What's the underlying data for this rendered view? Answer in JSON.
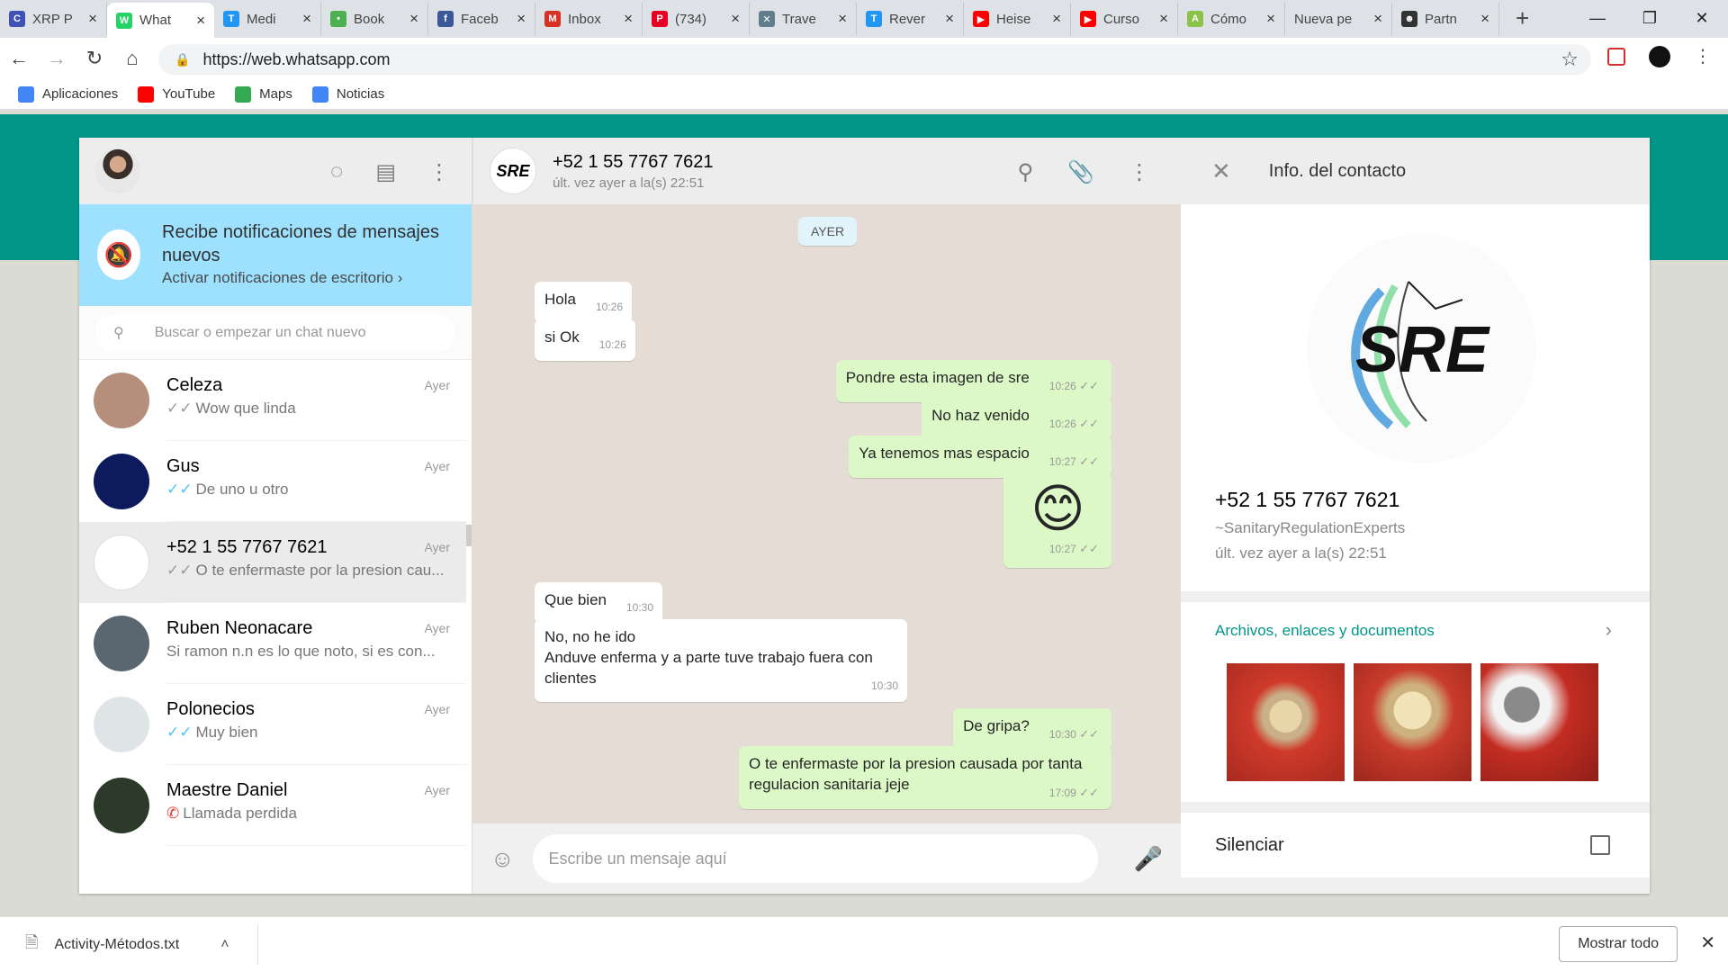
{
  "browser": {
    "tabs": [
      {
        "label": "XRP P",
        "color": "#3f51b5",
        "glyph": "C"
      },
      {
        "label": "What",
        "color": "#25d366",
        "glyph": "W",
        "active": true
      },
      {
        "label": "Medi",
        "color": "#2196f3",
        "glyph": "T"
      },
      {
        "label": "Book",
        "color": "#4caf50",
        "glyph": "•"
      },
      {
        "label": "Faceb",
        "color": "#3b5998",
        "glyph": "f"
      },
      {
        "label": "Inbox",
        "color": "#d93025",
        "glyph": "M"
      },
      {
        "label": "(734)",
        "color": "#e60023",
        "glyph": "P"
      },
      {
        "label": "Trave",
        "color": "#607d8b",
        "glyph": "✕"
      },
      {
        "label": "Rever",
        "color": "#2196f3",
        "glyph": "T"
      },
      {
        "label": "Heise",
        "color": "#ff0000",
        "glyph": "▶"
      },
      {
        "label": "Curso",
        "color": "#ff0000",
        "glyph": "▶"
      },
      {
        "label": "Cómo",
        "color": "#8bc34a",
        "glyph": "A"
      },
      {
        "label": "Nueva pe",
        "color": "",
        "glyph": ""
      },
      {
        "label": "Partn",
        "color": "#333333",
        "glyph": "☻"
      }
    ],
    "url": "https://web.whatsapp.com",
    "bookmarks": [
      {
        "label": "Aplicaciones",
        "color": "#4285f4"
      },
      {
        "label": "YouTube",
        "color": "#ff0000"
      },
      {
        "label": "Maps",
        "color": "#34a853"
      },
      {
        "label": "Noticias",
        "color": "#4285f4"
      }
    ]
  },
  "notification": {
    "title": "Recibe notificaciones de mensajes nuevos",
    "link": "Activar notificaciones de escritorio"
  },
  "search": {
    "placeholder": "Buscar o empezar un chat nuevo"
  },
  "chats": [
    {
      "name": "Celeza",
      "time": "Ayer",
      "preview": "Wow que linda",
      "tick": "gray",
      "avatar": "#b58f7c"
    },
    {
      "name": "Gus",
      "time": "Ayer",
      "preview": "De uno u otro",
      "tick": "blue",
      "avatar": "#0d1a5c"
    },
    {
      "name": "+52 1 55 7767 7621",
      "time": "Ayer",
      "preview": "O te enfermaste por la presion cau...",
      "tick": "gray",
      "avatar": "#ffffff",
      "selected": true
    },
    {
      "name": "Ruben Neonacare",
      "time": "Ayer",
      "preview": "Si ramon n.n es lo que noto, si es con...",
      "tick": "",
      "avatar": "#5a6670"
    },
    {
      "name": "Polonecios",
      "time": "Ayer",
      "preview": "Muy bien",
      "tick": "blue",
      "avatar": "#dfe5e7"
    },
    {
      "name": "Maestre Daniel",
      "time": "Ayer",
      "preview": "Llamada perdida",
      "tick": "missed",
      "avatar": "#2c3a2a"
    }
  ],
  "conversation": {
    "name": "+52 1 55 7767 7621",
    "status": "últ. vez ayer a la(s) 22:51",
    "date_chip": "AYER",
    "messages": [
      {
        "dir": "in",
        "text": "Hola",
        "time": "10:26"
      },
      {
        "dir": "in",
        "text": "si Ok",
        "time": "10:26"
      },
      {
        "dir": "out",
        "text": "Pondre esta imagen de sre",
        "time": "10:26"
      },
      {
        "dir": "out",
        "text": "No haz venido",
        "time": "10:26"
      },
      {
        "dir": "out",
        "text": "Ya tenemos mas espacio",
        "time": "10:27"
      },
      {
        "dir": "out",
        "text": "😊",
        "time": "10:27"
      },
      {
        "dir": "in",
        "text": "Que bien",
        "time": "10:30"
      },
      {
        "dir": "in",
        "text": "No, no he ido\nAnduve enferma y a parte tuve trabajo fuera con clientes",
        "time": "10:30"
      },
      {
        "dir": "out",
        "text": "De gripa?",
        "time": "10:30"
      },
      {
        "dir": "out",
        "text": "O te enfermaste por la presion causada por tanta regulacion sanitaria jeje",
        "time": "17:09"
      }
    ],
    "compose_placeholder": "Escribe un mensaje aquí"
  },
  "contact_info": {
    "header": "Info. del contacto",
    "name": "+52 1 55 7767 7621",
    "about": "~SanitaryRegulationExperts",
    "last_seen": "últ. vez ayer a la(s) 22:51",
    "logo_text": "SRE",
    "media_title": "Archivos, enlaces y documentos",
    "mute_label": "Silenciar"
  },
  "downloads": {
    "file": "Activity-Métodos.txt",
    "show_all": "Mostrar todo"
  }
}
